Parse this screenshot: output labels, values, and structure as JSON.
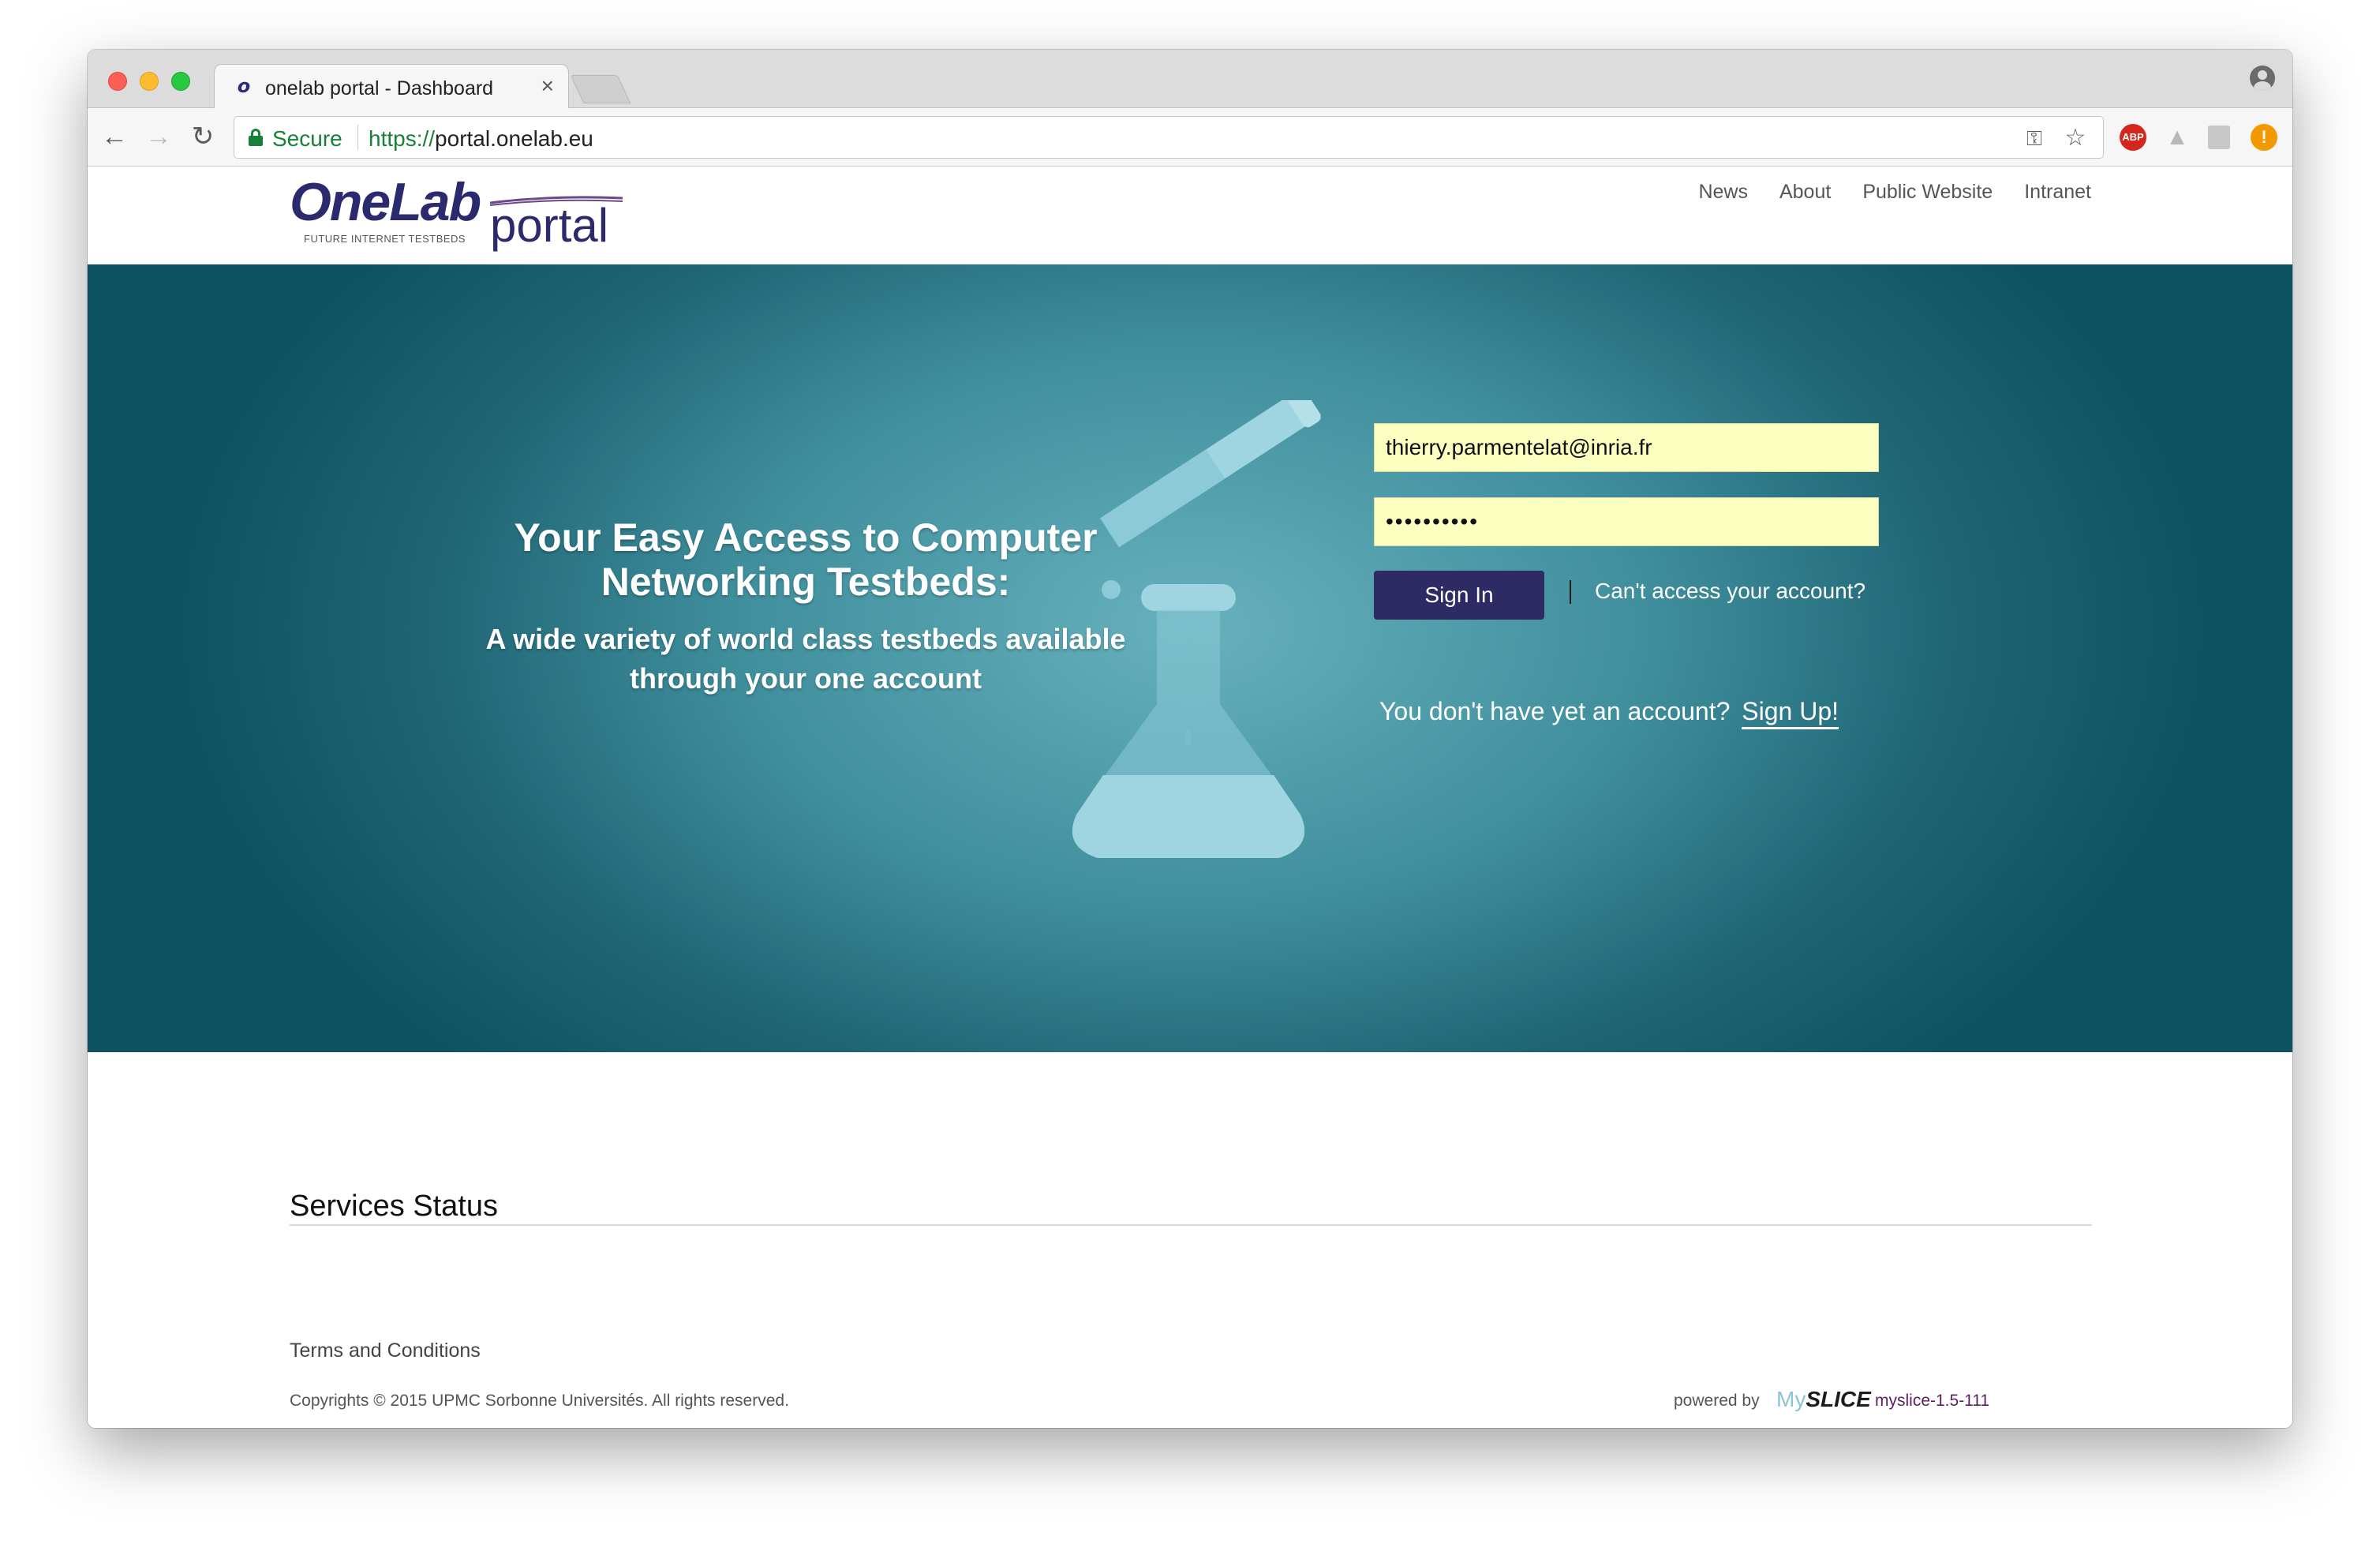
{
  "browser": {
    "tab_title": "onelab portal - Dashboard",
    "tab_favicon": "o",
    "close_glyph": "×",
    "security_label": "Secure",
    "url_scheme": "https://",
    "url_host": "portal.onelab.eu"
  },
  "header": {
    "logo_onelab": "OneLab",
    "logo_tagline": "FUTURE INTERNET TESTBEDS",
    "logo_portal": "portal",
    "nav": [
      "News",
      "About",
      "Public Website",
      "Intranet"
    ]
  },
  "hero": {
    "heading": "Your Easy Access to Computer Networking Testbeds:",
    "subheading": "A wide variety of world class testbeds available through your one account",
    "email_value": "thierry.parmentelat@inria.fr",
    "password_value": "••••••••••",
    "signin_label": "Sign In",
    "forgot_label": "Can't access your account?",
    "signup_prompt": "You don't have yet an account?",
    "signup_label": "Sign Up!"
  },
  "services": {
    "title": "Services Status"
  },
  "footer": {
    "terms": "Terms and Conditions",
    "copyright": "Copyrights © 2015 UPMC Sorbonne Universités. All rights reserved.",
    "powered_by": "powered by",
    "myslice_my": "My",
    "myslice_slice": "SLICE",
    "version": "myslice-1.5-111"
  },
  "colors": {
    "brand_navy": "#2b2a6e",
    "signin_button": "#2e2a63",
    "hero_teal_dark": "#0e5261",
    "hero_teal_light": "#67b1bd",
    "autofill_yellow": "#fbffbf",
    "secure_green": "#188038"
  },
  "icons": {
    "back": "arrow-left-icon",
    "forward": "arrow-right-icon",
    "reload": "reload-icon",
    "lock": "lock-icon",
    "key": "key-icon",
    "star": "star-icon",
    "profile": "profile-icon",
    "flask": "flask-icon"
  }
}
